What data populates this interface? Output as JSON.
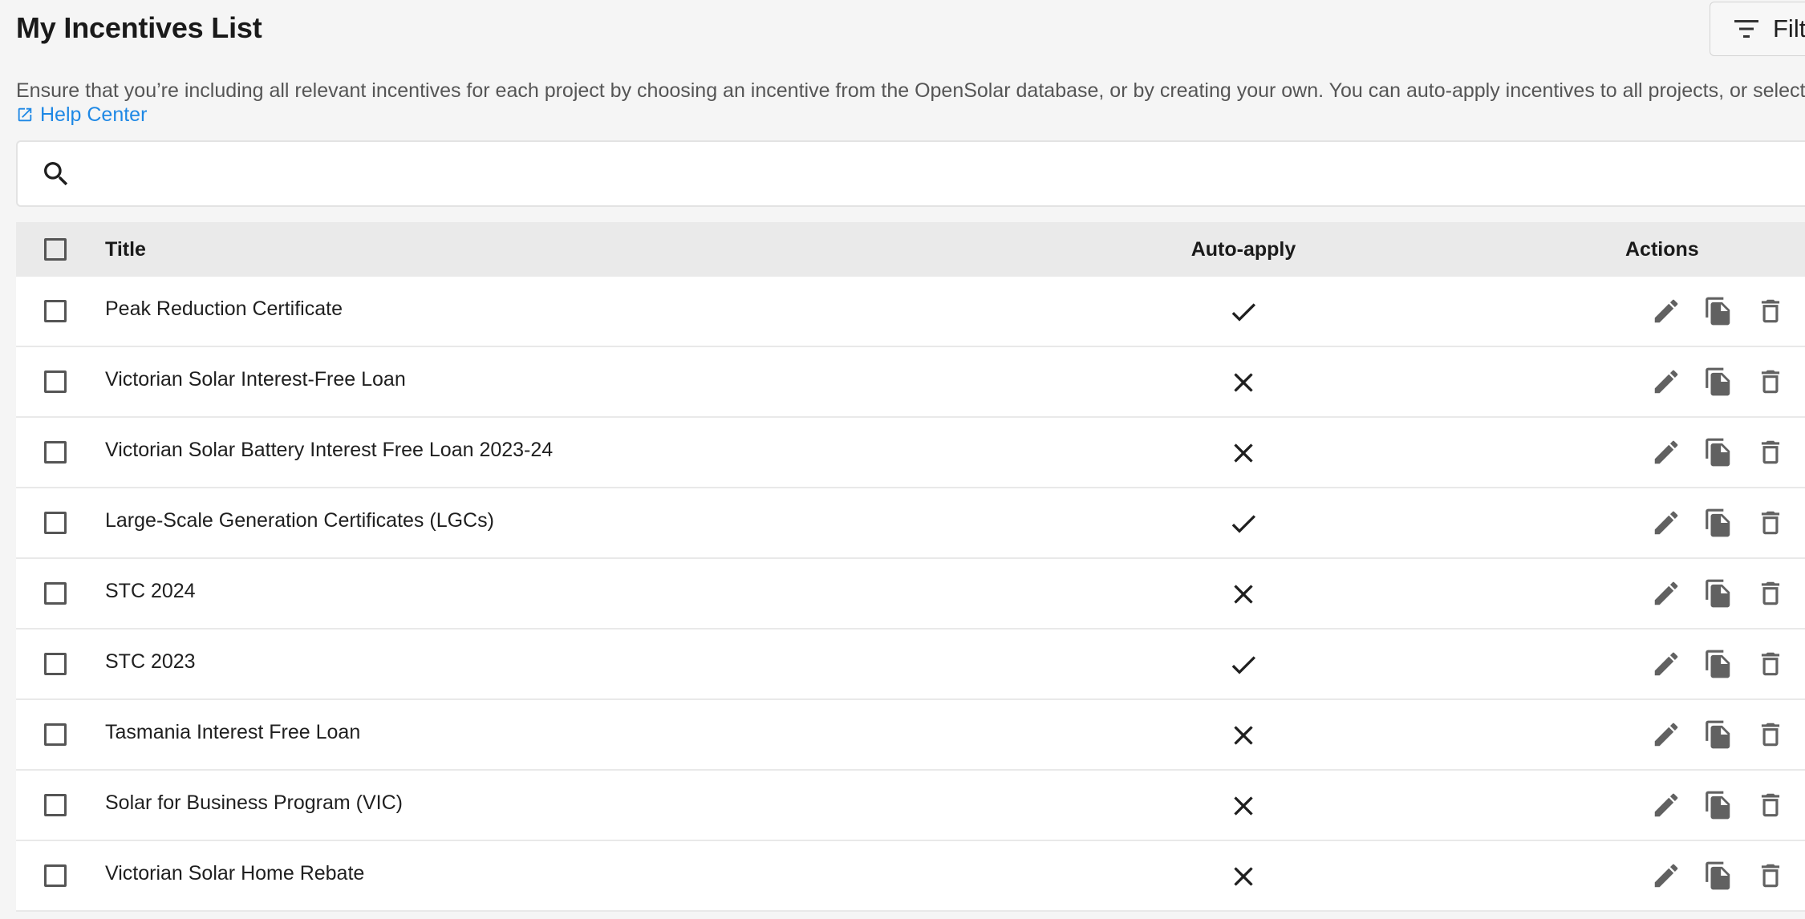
{
  "page": {
    "title": "My Incentives List",
    "description": "Ensure that you’re including all relevant incentives for each project by choosing an incentive from the OpenSolar database, or by creating your own. You can auto-apply incentives to all projects, or select",
    "help_link": "Help Center"
  },
  "toolbar": {
    "filter_label": "Filt",
    "filter_icon": "filter-icon"
  },
  "search": {
    "placeholder": "",
    "value": "",
    "icon": "search-icon"
  },
  "table": {
    "columns": {
      "title": "Title",
      "auto_apply": "Auto-apply",
      "actions": "Actions"
    },
    "rows": [
      {
        "title": "Peak Reduction Certificate",
        "auto_apply": true
      },
      {
        "title": "Victorian Solar Interest-Free Loan",
        "auto_apply": false
      },
      {
        "title": "Victorian Solar Battery Interest Free Loan 2023-24",
        "auto_apply": false
      },
      {
        "title": "Large-Scale Generation Certificates (LGCs)",
        "auto_apply": true
      },
      {
        "title": "STC 2024",
        "auto_apply": false
      },
      {
        "title": "STC 2023",
        "auto_apply": true
      },
      {
        "title": "Tasmania Interest Free Loan",
        "auto_apply": false
      },
      {
        "title": "Solar for Business Program (VIC)",
        "auto_apply": false
      },
      {
        "title": "Victorian Solar Home Rebate",
        "auto_apply": false
      }
    ],
    "row_actions": [
      "edit-icon",
      "copy-icon",
      "delete-icon"
    ]
  },
  "colors": {
    "link": "#1e88e5",
    "header_bg": "#eaeaea",
    "page_bg": "#f5f5f5",
    "icon": "#616161"
  }
}
